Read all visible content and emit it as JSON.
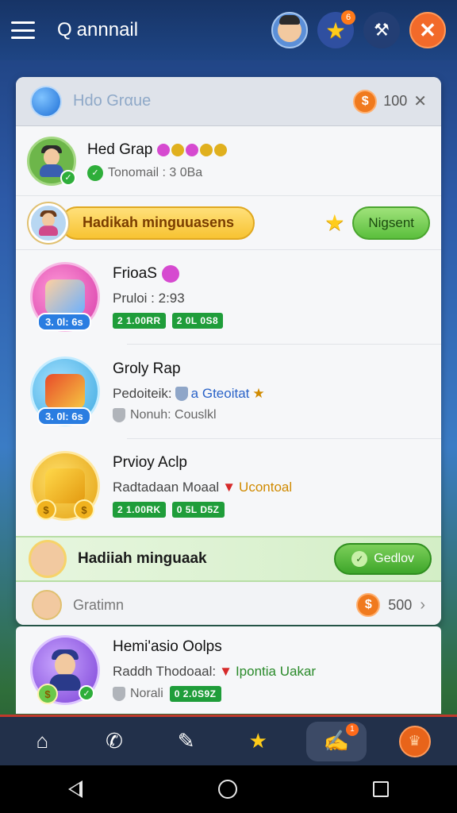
{
  "topbar": {
    "title": "annnail",
    "search_glyph": "Q",
    "notification_count": "6"
  },
  "card": {
    "header_title": "Hdo Grαue",
    "header_count": "100",
    "group": {
      "name": "Hed Grap",
      "subtitle": "Tonomail : 3 0Ba"
    },
    "promo": {
      "label": "Hadikah minguuasens",
      "button": "Nigsent"
    },
    "items": [
      {
        "title": "FrioaS",
        "line2": "Pruloi : 2:93",
        "badge": "3. 0l: 6s",
        "tag1": "2 1.00RR",
        "tag2": "2 0L 0S8",
        "color": "pink"
      },
      {
        "title": "Groly Rap",
        "line2_prefix": "Pedoiteik:",
        "line2_accent": "a Gteoitat",
        "line3": "Nonuh: Couslkl",
        "badge": "3. 0l: 6s"
      },
      {
        "title": "Prvioy Aclp",
        "line2_prefix": "Radtadaan Moaal",
        "line2_accent": "Ucontoal",
        "tag1": "2 1.00RK",
        "tag2": "0 5L D5Z"
      }
    ],
    "banner": {
      "text": "Hadiiah minguaak",
      "button": "Gedlov"
    },
    "footer": {
      "label": "Gratimn",
      "count": "500"
    }
  },
  "card2": {
    "title": "Hemi'asio Oolps",
    "line2_prefix": "Raddh Thodoaal:",
    "line2_accent": "Ipontia Uakar",
    "muted": "Norali",
    "tag": "0 2.0S9Z"
  },
  "bottomnav": {
    "badge": "1"
  },
  "colors": {
    "accent_orange": "#f26a2a",
    "accent_green": "#3ea62a",
    "tag_green": "#1f9d3a",
    "nav_bg": "#22304a"
  }
}
